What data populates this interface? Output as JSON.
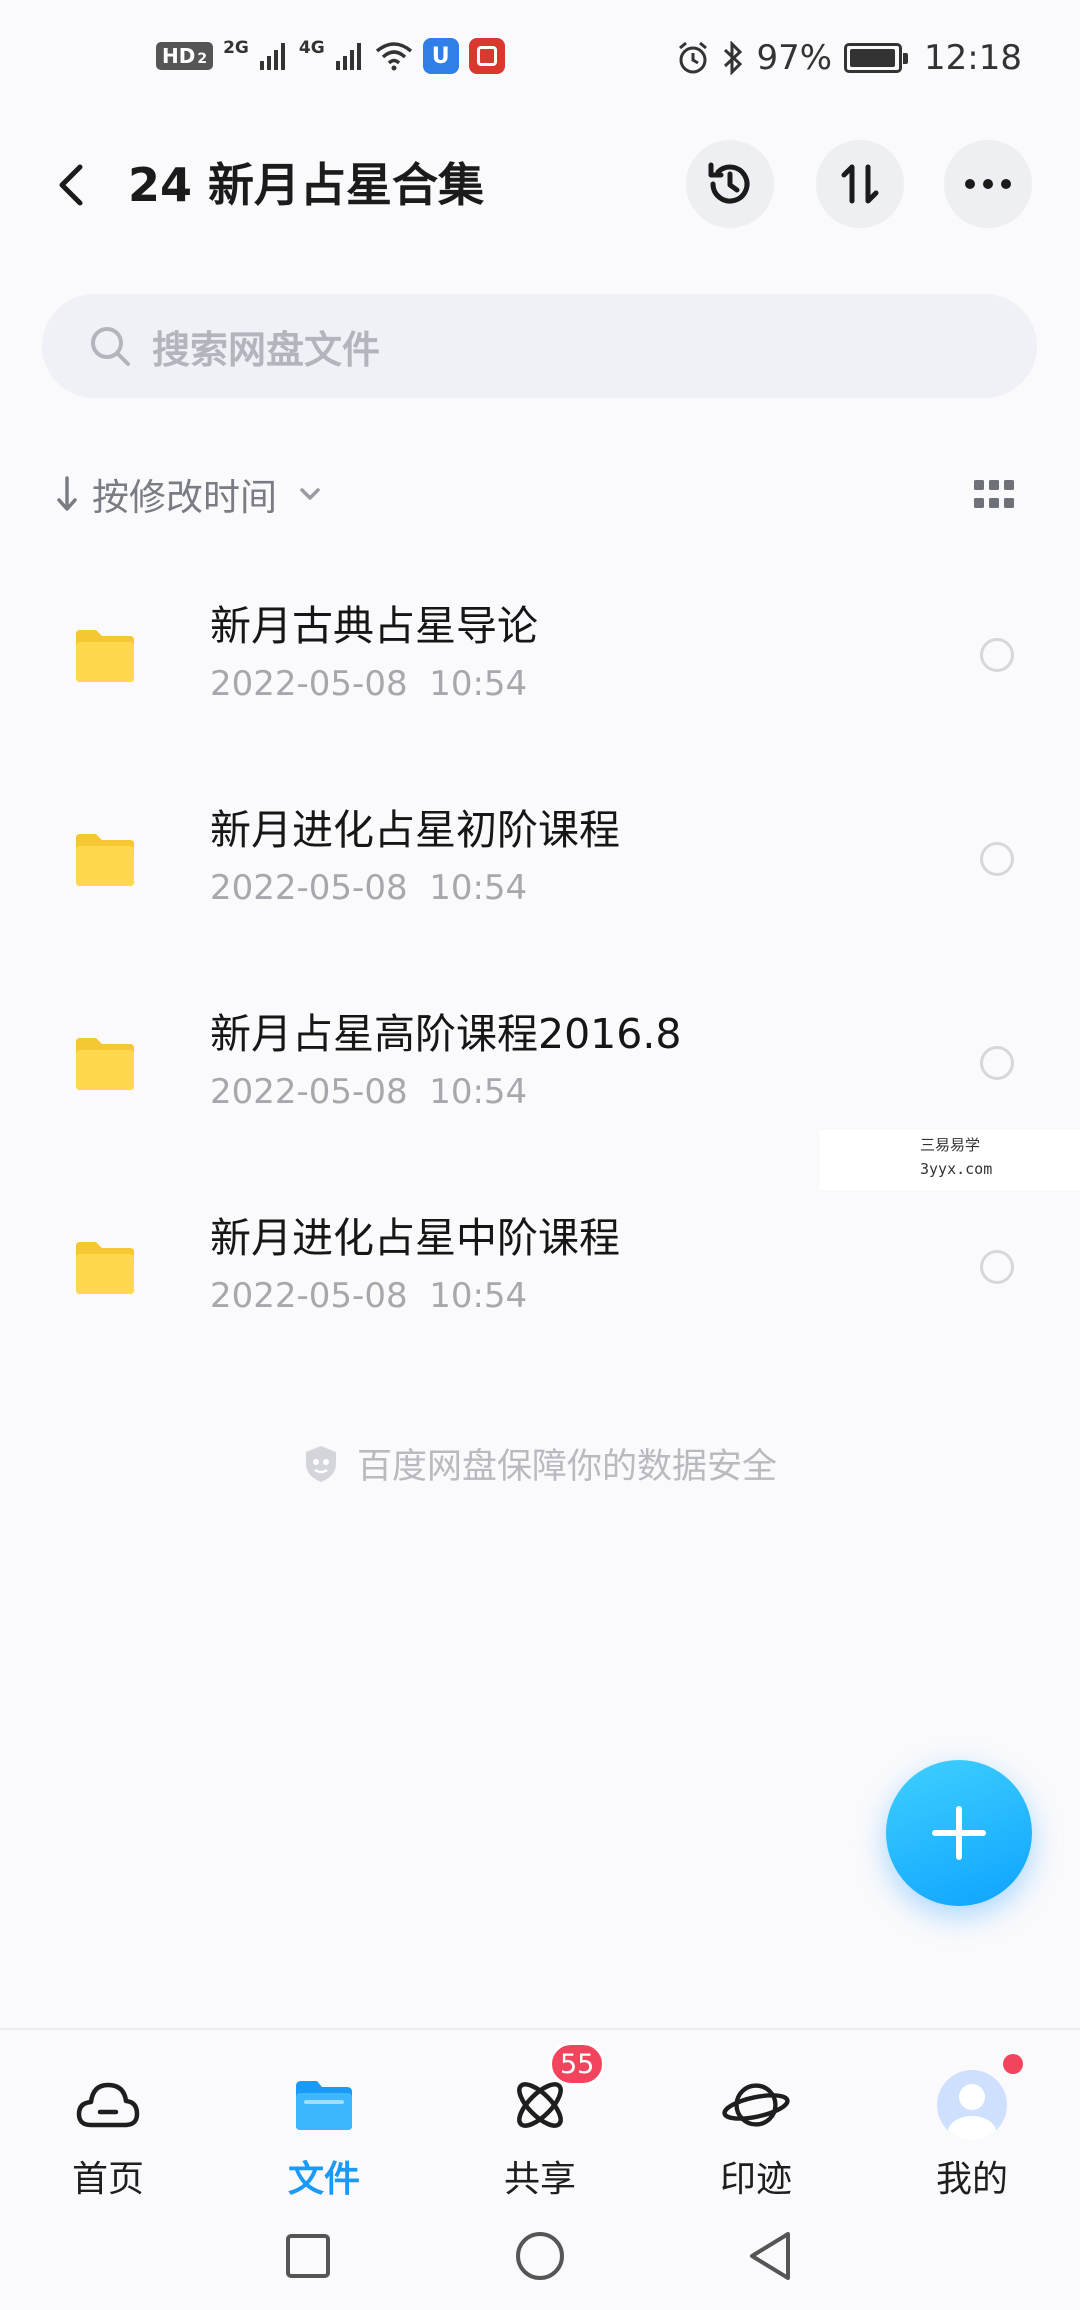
{
  "status_bar": {
    "network_badge": "HD",
    "network_badge_sub": "2",
    "sim1": "2G",
    "sim2": "4G",
    "battery_text": "97%",
    "battery_level": 0.97,
    "time": "12:18"
  },
  "header": {
    "title": "24 新月占星合集",
    "icons": [
      "back-icon",
      "history-icon",
      "sort-swap-icon",
      "more-icon"
    ]
  },
  "search": {
    "placeholder": "搜索网盘文件"
  },
  "sort": {
    "label": "按修改时间"
  },
  "files": [
    {
      "name": "新月古典占星导论",
      "date": "2022-05-08  10:54"
    },
    {
      "name": "新月进化占星初阶课程",
      "date": "2022-05-08  10:54"
    },
    {
      "name": "新月占星高阶课程2016.8",
      "date": "2022-05-08  10:54"
    },
    {
      "name": "新月进化占星中阶课程",
      "date": "2022-05-08  10:54"
    }
  ],
  "watermark": {
    "line1": "三易易学",
    "line2": "3yyx.com"
  },
  "security_note": "百度网盘保障你的数据安全",
  "bottom_nav": {
    "tabs": [
      {
        "label": "首页",
        "icon": "cloud-icon"
      },
      {
        "label": "文件",
        "icon": "folder-icon",
        "active": true
      },
      {
        "label": "共享",
        "icon": "share-atom-icon",
        "badge": "55"
      },
      {
        "label": "印迹",
        "icon": "planet-icon"
      },
      {
        "label": "我的",
        "icon": "avatar-icon"
      }
    ]
  },
  "colors": {
    "accent": "#1a9af7",
    "folder": "#ffd54a",
    "badge": "#f2455d"
  }
}
